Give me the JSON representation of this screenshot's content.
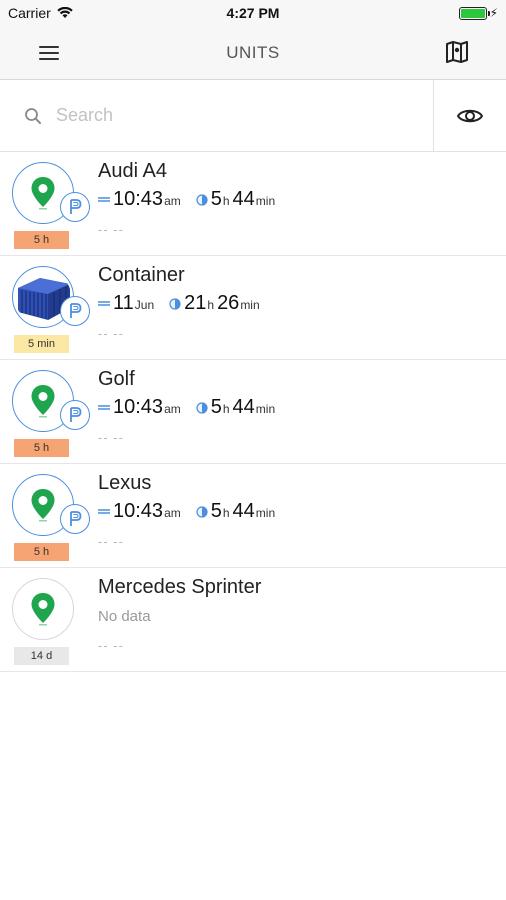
{
  "status_bar": {
    "carrier": "Carrier",
    "time": "4:27 PM"
  },
  "nav": {
    "title": "UNITS"
  },
  "search": {
    "placeholder": "Search"
  },
  "units": [
    {
      "name": "Audi A4",
      "time_main": "10:43",
      "time_suffix": "am",
      "duration_h": "5",
      "duration_h_unit": "h",
      "duration_m": "44",
      "duration_m_unit": "min",
      "age": "5 h",
      "footer": "-- --"
    },
    {
      "name": "Container",
      "time_main": "11",
      "time_suffix": "Jun",
      "duration_h": "21",
      "duration_h_unit": "h",
      "duration_m": "26",
      "duration_m_unit": "min",
      "age": "5 min",
      "footer": "-- --"
    },
    {
      "name": "Golf",
      "time_main": "10:43",
      "time_suffix": "am",
      "duration_h": "5",
      "duration_h_unit": "h",
      "duration_m": "44",
      "duration_m_unit": "min",
      "age": "5 h",
      "footer": "-- --"
    },
    {
      "name": "Lexus",
      "time_main": "10:43",
      "time_suffix": "am",
      "duration_h": "5",
      "duration_h_unit": "h",
      "duration_m": "44",
      "duration_m_unit": "min",
      "age": "5 h",
      "footer": "-- --"
    },
    {
      "name": "Mercedes Sprinter",
      "status": "No data",
      "age": "14 d",
      "footer": "-- --"
    }
  ],
  "colors": {
    "accent": "#4a8fe0",
    "pin": "#1fa54e",
    "age_orange": "#f7a474",
    "age_yellow": "#fce8a5",
    "age_grey": "#e8e8e8"
  },
  "icons": {
    "menu": "hamburger-icon",
    "map": "map-icon",
    "search": "search-icon",
    "visibility": "eye-icon",
    "parking": "parking-icon",
    "pin": "location-pin-icon",
    "container": "shipping-container-icon",
    "clock": "clock-icon",
    "time": "last-message-icon"
  }
}
